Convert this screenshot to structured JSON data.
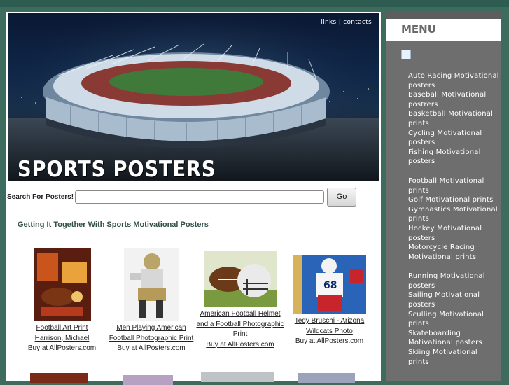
{
  "header": {
    "links": [
      "links",
      "contacts"
    ],
    "separator": "|",
    "logo_text": "SPORTS POSTERS"
  },
  "search": {
    "label": "Search For Posters!",
    "value": "",
    "placeholder": "",
    "button_label": "Go"
  },
  "main": {
    "heading": "Getting It Together With Sports Motivational Posters",
    "products": [
      {
        "lines": [
          "Football Art Print",
          "Harrison, Michael"
        ],
        "buy": "Buy at AllPosters.com"
      },
      {
        "lines": [
          "Men Playing American",
          "Football Photographic Print"
        ],
        "buy": "Buy at AllPosters.com"
      },
      {
        "lines": [
          "American Football Helmet",
          "and a Football Photographic",
          "Print"
        ],
        "buy": "Buy at AllPosters.com"
      },
      {
        "lines": [
          "Tedy Bruschi - Arizona",
          "Wildcats Photo"
        ],
        "buy": "Buy at AllPosters.com"
      }
    ]
  },
  "sidebar": {
    "title": "MENU",
    "groups": [
      [
        "Auto Racing Motivational posters",
        "Baseball Motivational postrers",
        "Basketball Motivational prints",
        "Cycling Motivational posters",
        "Fishing Motivational posters"
      ],
      [
        "Football Motivational prints",
        "Golf Motivational prints",
        "Gymnastics Motivational prints",
        "Hockey Motivational posters",
        "Motorcycle Racing Motivational prints"
      ],
      [
        "Running Motivational posters",
        "Sailing Motivational posters",
        "Sculling Motivational prints",
        "Skateboarding Motivational posters",
        "Skiing Motivational prints"
      ]
    ]
  },
  "colors": {
    "page_background": "#3d6b5e",
    "sidebar_background": "#6e6e6e",
    "heading_color": "#34504a",
    "menu_text": "#ffffff"
  },
  "icons": [
    "stadium-photo",
    "sidebar-icon",
    "football-art-thumb",
    "football-player-thumb",
    "helmet-football-thumb",
    "bruschi-thumb"
  ]
}
